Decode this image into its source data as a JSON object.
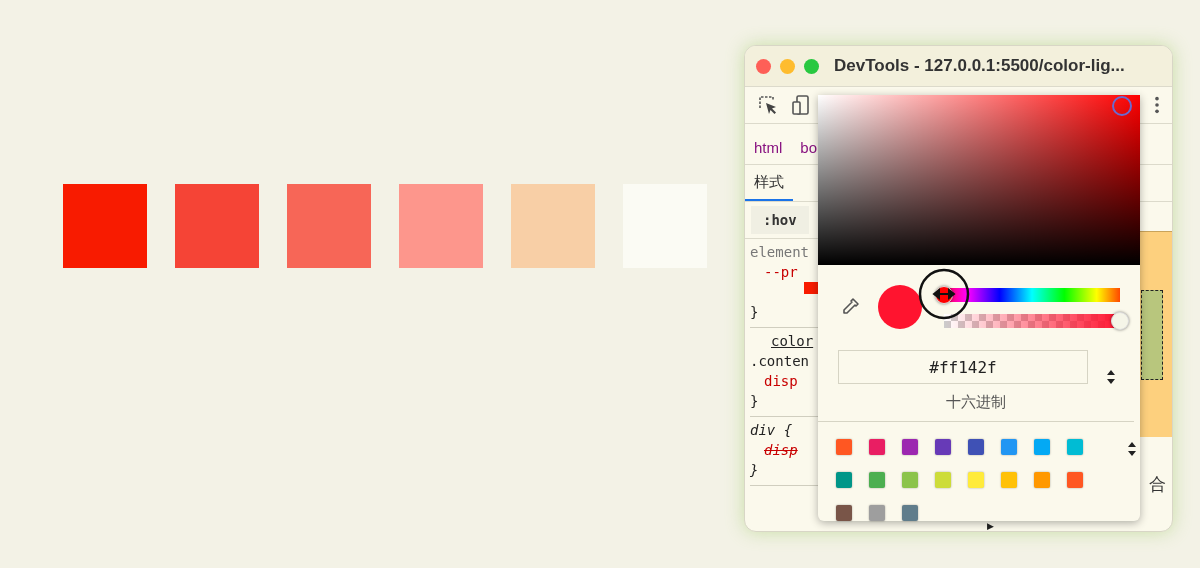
{
  "squares": [
    {
      "color": "#f81b00"
    },
    {
      "color": "#f54436"
    },
    {
      "color": "#f76657"
    },
    {
      "color": "#fd968c"
    },
    {
      "color": "#f8cfa6"
    },
    {
      "color": "#fbfbf4"
    }
  ],
  "devtools": {
    "title": "DevTools - 127.0.0.1:5500/color-lig...",
    "breadcrumbs": [
      "html",
      "bo"
    ],
    "tabs": [
      {
        "label": "样式",
        "selected": true
      }
    ],
    "filter": ":hov",
    "rules": [
      {
        "lines": [
          {
            "kind": "muted",
            "text": "element"
          },
          {
            "kind": "property",
            "text": "--pr"
          },
          {
            "kind": "swatch",
            "color": "#f81b00"
          },
          {
            "kind": "brace",
            "text": "}"
          }
        ]
      },
      {
        "lines": [
          {
            "kind": "link",
            "text": "color"
          },
          {
            "kind": "selector",
            "text": ".conten"
          },
          {
            "kind": "property",
            "text": "disp"
          },
          {
            "kind": "brace",
            "text": "}"
          }
        ]
      },
      {
        "lines": [
          {
            "kind": "italic",
            "text": "div {"
          },
          {
            "kind": "struck",
            "text": "disp"
          },
          {
            "kind": "italic",
            "text": "}"
          }
        ]
      }
    ],
    "box_label": "合",
    "expander": "▶"
  },
  "color_picker": {
    "hue": {
      "level": 0
    },
    "alpha": {
      "level": 1
    },
    "hex": "#ff142f",
    "format": "十六进制",
    "palette": [
      {
        "color": "#ff5722"
      },
      {
        "color": "#e91e63"
      },
      {
        "color": "#9c27b0"
      },
      {
        "color": "#673ab7"
      },
      {
        "color": "#3f51b5"
      },
      {
        "color": "#2196f3"
      },
      {
        "color": "#03a9f4"
      },
      {
        "color": "#00bcd4"
      },
      {
        "color": "#009688"
      },
      {
        "color": "#4caf50"
      },
      {
        "color": "#8bc34a"
      },
      {
        "color": "#cddc39"
      },
      {
        "color": "#ffeb3b"
      },
      {
        "color": "#ffc107"
      },
      {
        "color": "#ff9800"
      },
      {
        "color": "#ff5722"
      },
      {
        "color": "#795548"
      },
      {
        "color": "#9e9e9e"
      },
      {
        "color": "#607d8b"
      }
    ]
  }
}
